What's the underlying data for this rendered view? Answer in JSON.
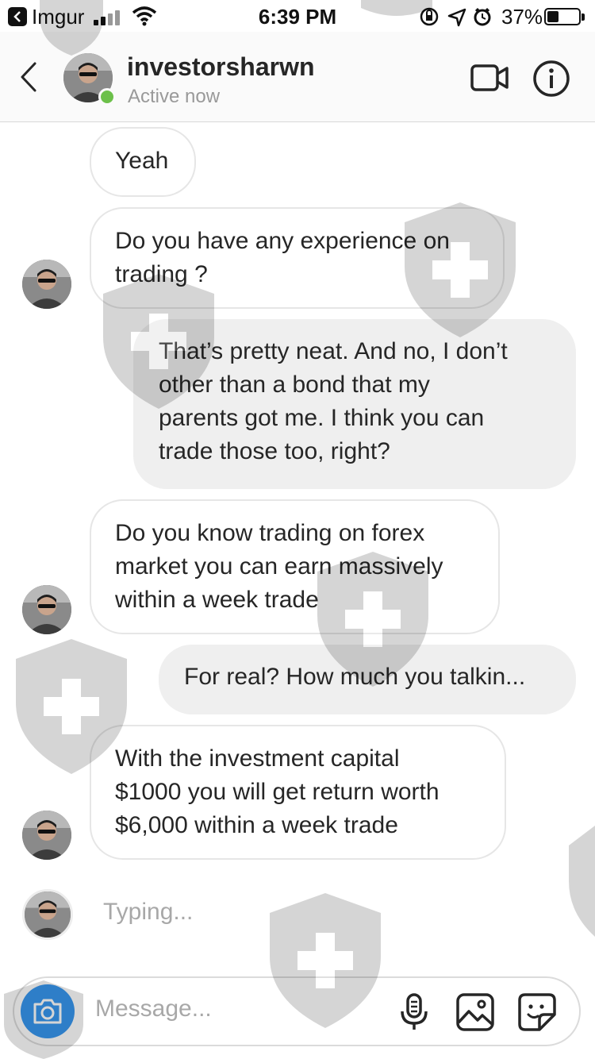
{
  "status_bar": {
    "back_app": "Imgur",
    "time": "6:39 PM",
    "battery": "37%",
    "battery_level": 0.37
  },
  "header": {
    "username": "investorsharwn",
    "status": "Active now"
  },
  "messages": [
    {
      "from": "them",
      "lines": [
        "Yeah"
      ]
    },
    {
      "from": "them",
      "lines": [
        "Do you have any experience on",
        "trading ?"
      ]
    },
    {
      "from": "me",
      "lines": [
        "That’s pretty neat. And no, I don’t",
        "other than a bond that my",
        "parents got me. I think you can",
        "trade those too, right?"
      ]
    },
    {
      "from": "them",
      "lines": [
        "Do you know trading on forex",
        "market you can earn massively",
        "within a week trade"
      ]
    },
    {
      "from": "me",
      "lines": [
        "For real? How much you talkin..."
      ]
    },
    {
      "from": "them",
      "lines": [
        "With the investment capital",
        "$1000 you will get return worth",
        "$6,000 within a week trade"
      ]
    }
  ],
  "typing_indicator": "Typing...",
  "composer": {
    "placeholder": "Message..."
  },
  "icons": {
    "back": "chevron-left-icon",
    "video": "video-camera-icon",
    "info": "info-icon",
    "camera": "camera-icon",
    "mic": "microphone-icon",
    "gallery": "image-icon",
    "sticker": "sticker-icon"
  },
  "colors": {
    "accent": "#3897f0",
    "online": "#6cc04a",
    "outgoing_bubble": "#efefef",
    "incoming_border": "#e6e6e6"
  }
}
